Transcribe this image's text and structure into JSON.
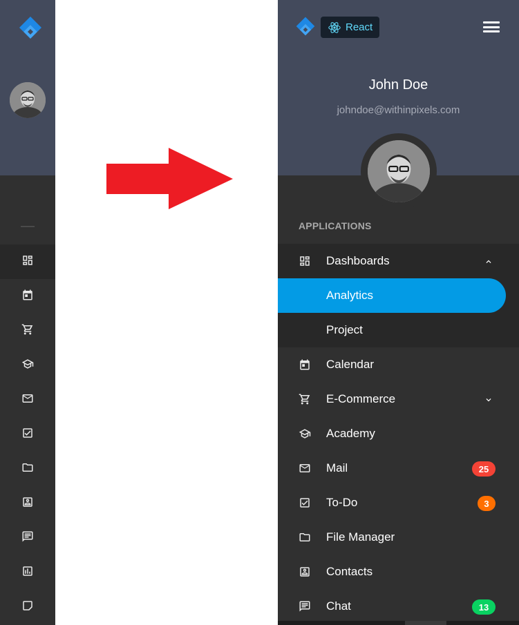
{
  "brand": {
    "framework_badge": "React",
    "accent_color": "#039be5",
    "header_color": "#434a5c",
    "nav_background": "#303030"
  },
  "user": {
    "name": "John Doe",
    "email": "johndoe@withinpixels.com"
  },
  "navigation": {
    "section_title": "APPLICATIONS",
    "items": [
      {
        "label": "Dashboards",
        "icon": "dashboard-icon",
        "expanded": true,
        "chevron": "chevron-up-icon"
      },
      {
        "label": "Analytics",
        "child": true,
        "active": true
      },
      {
        "label": "Project",
        "child": true
      },
      {
        "label": "Calendar",
        "icon": "calendar-icon"
      },
      {
        "label": "E-Commerce",
        "icon": "shopping-cart-icon",
        "chevron": "chevron-down-icon"
      },
      {
        "label": "Academy",
        "icon": "school-icon"
      },
      {
        "label": "Mail",
        "icon": "mail-icon",
        "badge": "25",
        "badge_color": "#f44336"
      },
      {
        "label": "To-Do",
        "icon": "check-box-icon",
        "badge": "3",
        "badge_color": "#ff6f00"
      },
      {
        "label": "File Manager",
        "icon": "folder-icon"
      },
      {
        "label": "Contacts",
        "icon": "contacts-icon"
      },
      {
        "label": "Chat",
        "icon": "chat-icon",
        "badge": "13",
        "badge_color": "#09d261"
      }
    ]
  },
  "mini_navigation": {
    "icons": [
      "dashboard-icon",
      "calendar-icon",
      "shopping-cart-icon",
      "school-icon",
      "mail-icon",
      "check-box-icon",
      "folder-icon",
      "contacts-icon",
      "chat-icon",
      "chart-icon",
      "note-icon"
    ]
  },
  "annotation": {
    "arrow_color": "#ed1c24"
  }
}
